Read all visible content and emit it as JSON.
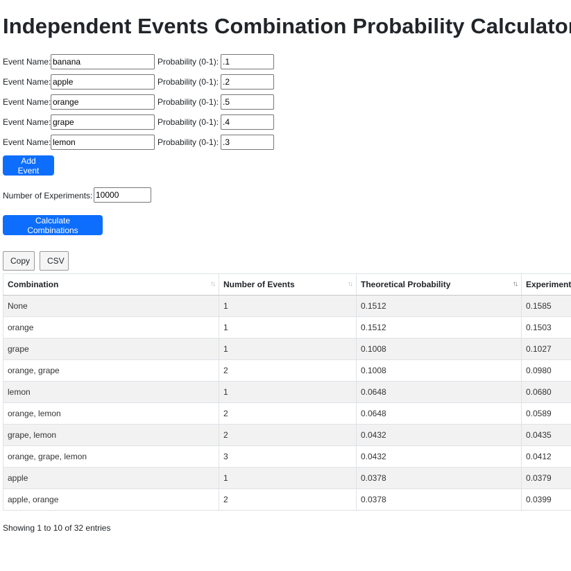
{
  "page": {
    "title": "Independent Events Combination Probability Calculator"
  },
  "events": [
    {
      "name_label": "Event Name:",
      "name": "banana",
      "prob_label": "Probability (0-1):",
      "prob": ".1"
    },
    {
      "name_label": "Event Name:",
      "name": "apple",
      "prob_label": "Probability (0-1):",
      "prob": ".2"
    },
    {
      "name_label": "Event Name:",
      "name": "orange",
      "prob_label": "Probability (0-1):",
      "prob": ".5"
    },
    {
      "name_label": "Event Name:",
      "name": "grape",
      "prob_label": "Probability (0-1):",
      "prob": ".4"
    },
    {
      "name_label": "Event Name:",
      "name": "lemon",
      "prob_label": "Probability (0-1):",
      "prob": ".3"
    }
  ],
  "add_event_label": "Add Event",
  "experiments": {
    "label": "Number of Experiments:",
    "value": "10000"
  },
  "calculate_label": "Calculate Combinations",
  "table_buttons": {
    "copy": "Copy",
    "csv": "CSV"
  },
  "table": {
    "headers": [
      "Combination",
      "Number of Events",
      "Theoretical Probability",
      "Experimental Probability"
    ],
    "sort_icons": {
      "unsorted": "↑↓",
      "descending": "↑↓"
    },
    "rows": [
      [
        "None",
        "1",
        "0.1512",
        "0.1585"
      ],
      [
        "orange",
        "1",
        "0.1512",
        "0.1503"
      ],
      [
        "grape",
        "1",
        "0.1008",
        "0.1027"
      ],
      [
        "orange, grape",
        "2",
        "0.1008",
        "0.0980"
      ],
      [
        "lemon",
        "1",
        "0.0648",
        "0.0680"
      ],
      [
        "orange, lemon",
        "2",
        "0.0648",
        "0.0589"
      ],
      [
        "grape, lemon",
        "2",
        "0.0432",
        "0.0435"
      ],
      [
        "orange, grape, lemon",
        "3",
        "0.0432",
        "0.0412"
      ],
      [
        "apple",
        "1",
        "0.0378",
        "0.0379"
      ],
      [
        "apple, orange",
        "2",
        "0.0378",
        "0.0399"
      ]
    ]
  },
  "info_text": "Showing 1 to 10 of 32 entries",
  "colors": {
    "primary": "#0d6efd",
    "stripe": "#f2f2f2",
    "border": "#dee2e6"
  }
}
